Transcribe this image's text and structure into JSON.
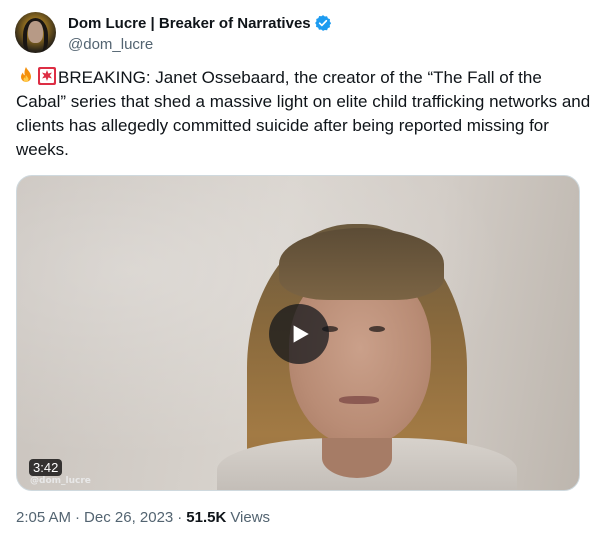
{
  "author": {
    "display_name": "Dom Lucre | Breaker of Narratives",
    "handle": "@dom_lucre",
    "verified": true,
    "avatar_icon": "profile-avatar",
    "verified_color": "#1d9bf0"
  },
  "tweet": {
    "emojis": [
      "fire-emoji",
      "rotating-light-emoji"
    ],
    "text": "BREAKING: Janet Ossebaard, the creator of the “The Fall of the Cabal” series that shed a massive light on elite child trafficking networks and clients has allegedly committed suicide after being reported missing for weeks."
  },
  "media": {
    "type": "video",
    "duration": "3:42",
    "watermark": "@dom_lucre",
    "play_icon": "play-icon"
  },
  "meta": {
    "time": "2:05 AM",
    "separator": "·",
    "date": "Dec 26, 2023",
    "views_count": "51.5K",
    "views_label": "Views"
  }
}
